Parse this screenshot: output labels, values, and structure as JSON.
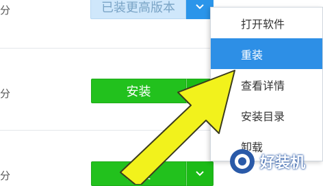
{
  "rows": [
    {
      "label": "分",
      "button_label": "已装更高版本",
      "state": "installed"
    },
    {
      "label": "分",
      "button_label": "安装",
      "state": "install"
    },
    {
      "label": "分",
      "button_label": "安装",
      "state": "install"
    }
  ],
  "menu": {
    "items": [
      "打开软件",
      "重装",
      "查看详情",
      "安装目录",
      "卸载"
    ],
    "active_index": 1
  },
  "watermark": {
    "text": "好装机"
  },
  "colors": {
    "green_button": "#22c11d",
    "blue_dropdown": "#2b95ea",
    "menu_highlight": "#2d8fe6",
    "arrow": "#f2f21c"
  },
  "icons": {
    "dropdown": "chevron-down-icon",
    "pointer": "yellow-arrow-annotation",
    "logo": "haozhuangji-logo-icon"
  }
}
